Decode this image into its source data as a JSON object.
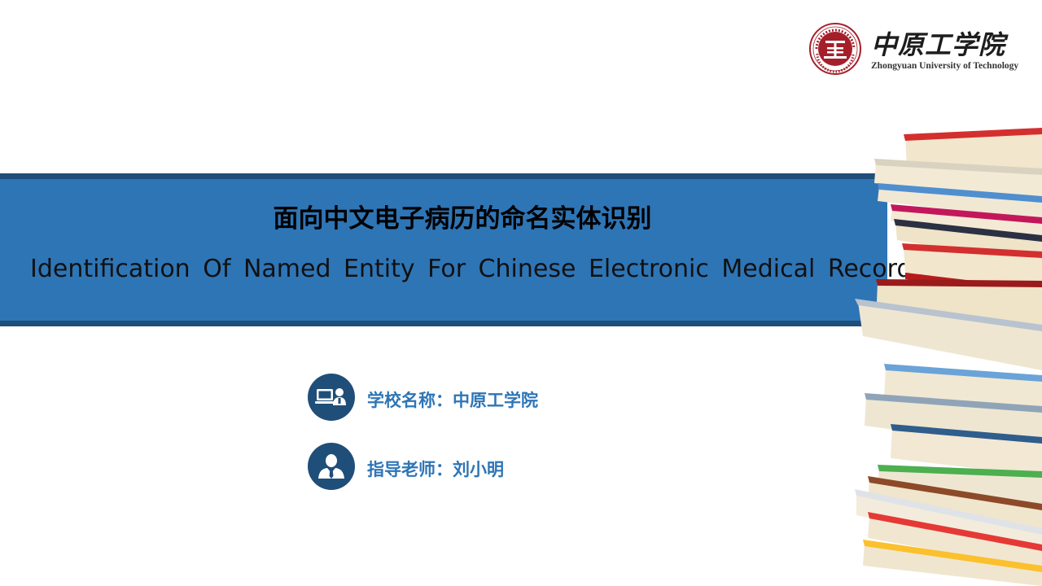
{
  "logo": {
    "name_cn": "中原工学院",
    "name_en": "Zhongyuan University of Technology",
    "seal_text": "ZHONGYUAN UNIVERSITY OF TECHNOLOGY",
    "seal_char": "工"
  },
  "title": {
    "cn": "面向中文电子病历的命名实体识别",
    "en": "Identification Of Named Entity For Chinese Electronic Medical Records"
  },
  "info": {
    "school": "学校名称：中原工学院",
    "advisor": "指导老师：刘小明"
  },
  "icons": {
    "school": "computer-user-icon",
    "advisor": "businessman-icon"
  },
  "colors": {
    "band": "#2e75b6",
    "band_border": "#1f4e79",
    "info_text": "#2e75b6",
    "icon_circle": "#1f4e79",
    "seal": "#a51f2a"
  }
}
